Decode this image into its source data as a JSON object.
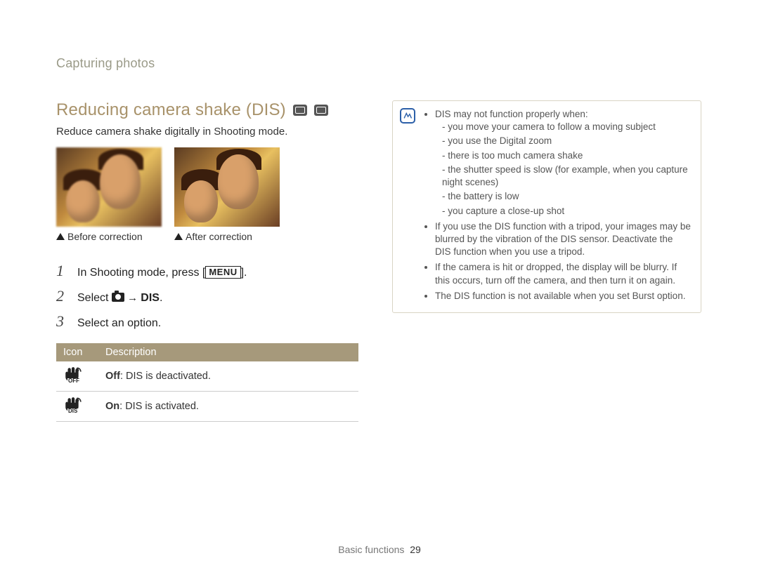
{
  "breadcrumb": "Capturing photos",
  "heading": "Reducing camera shake (DIS)",
  "mode_icons": [
    "program-mode-icon",
    "scene-mode-icon"
  ],
  "subtitle": "Reduce camera shake digitally in Shooting mode.",
  "captions": {
    "before": "Before correction",
    "after": "After correction"
  },
  "steps": [
    {
      "num": "1",
      "text_pre": "In Shooting mode, press [",
      "menu_label": "MENU",
      "text_post": "]."
    },
    {
      "num": "2",
      "text_pre": "Select ",
      "use_cam": true,
      "arrow": " → ",
      "bold_post": "DIS",
      "text_post": "."
    },
    {
      "num": "3",
      "text_pre": "Select an option."
    }
  ],
  "options_table": {
    "headers": [
      "Icon",
      "Description"
    ],
    "rows": [
      {
        "icon_sub": "OFF",
        "bold": "Off",
        "rest": ": DIS is deactivated."
      },
      {
        "icon_sub": "DIS",
        "bold": "On",
        "rest": ": DIS is activated."
      }
    ]
  },
  "note": {
    "intro": "DIS may not function properly when:",
    "reasons": [
      "you move your camera to follow a moving subject",
      "you use the Digital zoom",
      "there is too much camera shake",
      "the shutter speed is slow (for example, when you capture night scenes)",
      "the battery is low",
      "you capture a close-up shot"
    ],
    "bullets": [
      "If you use the DIS function with a tripod, your images may be blurred by the vibration of the DIS sensor. Deactivate the DIS function when you use a tripod.",
      "If the camera is hit or dropped, the display will be blurry. If this occurs, turn off the camera, and then turn it on again.",
      "The DIS function is not available when you set Burst option."
    ]
  },
  "footer": {
    "section": "Basic functions",
    "page": "29"
  }
}
